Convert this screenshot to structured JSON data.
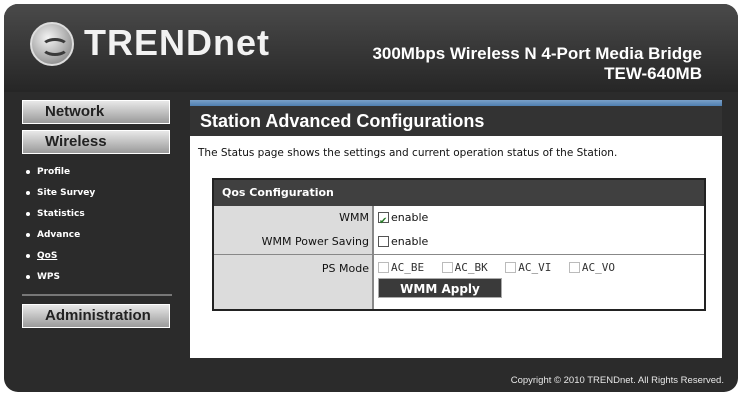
{
  "header": {
    "logo_text": "TRENDnet",
    "product_title": "300Mbps Wireless N 4-Port Media Bridge",
    "model": "TEW-640MB"
  },
  "sidebar": {
    "network": "Network",
    "wireless": "Wireless",
    "items": [
      {
        "label": "Profile"
      },
      {
        "label": "Site Survey"
      },
      {
        "label": "Statistics"
      },
      {
        "label": "Advance"
      },
      {
        "label": "QoS"
      },
      {
        "label": "WPS"
      }
    ],
    "administration": "Administration"
  },
  "main": {
    "title": "Station Advanced Configurations",
    "description": "The Status page shows the settings and current operation status of the Station.",
    "qos": {
      "heading": "Qos Configuration",
      "wmm_label": "WMM",
      "wmm_checked": true,
      "wmm_option": "enable",
      "wmm_ps_label": "WMM Power Saving",
      "wmm_ps_checked": false,
      "wmm_ps_option": "enable",
      "ps_mode_label": "PS Mode",
      "ps_options": [
        "AC_BE",
        "AC_BK",
        "AC_VI",
        "AC_VO"
      ],
      "apply_label": "WMM Apply"
    }
  },
  "footer": {
    "copyright": "Copyright © 2010 TRENDnet. All Rights Reserved."
  }
}
